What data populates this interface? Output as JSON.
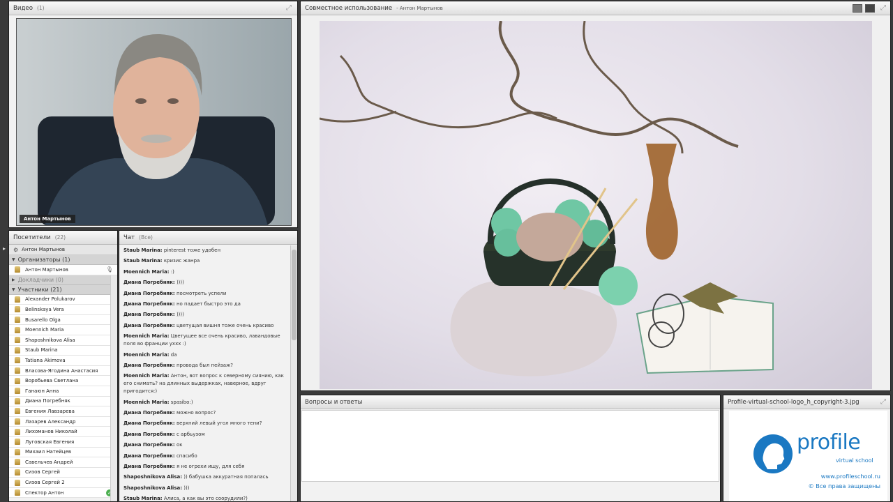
{
  "video": {
    "title": "Видео",
    "count": "(1)",
    "cam_name": "Антон Мартынов"
  },
  "share": {
    "title": "Совместное использование",
    "presenter": "- Антон Мартынов"
  },
  "attendees": {
    "title": "Посетители",
    "count": "(22)",
    "presenter": "Антон Мартынов",
    "groups": {
      "organizers": "Организаторы (1)",
      "speakers": "Докладчики (0)",
      "participants": "Участники (21)"
    },
    "organizers": [
      "Антон Мартынов"
    ],
    "participants": [
      "Alexander Polukarov",
      "Belinskaya Vera",
      "Busarello Olga",
      "Moennich Maria",
      "Shaposhnikova Alisa",
      "Staub Marina",
      "Tatiana Akimova",
      "Власова-Ягодина Анастасия",
      "Воробьева Светлана",
      "Ганаюн Анна",
      "Диана Погребняк",
      "Евгения Лавзарева",
      "Лазарев Александр",
      "Лихоманов Николай",
      "Луговская Евгения",
      "Михаил Натейцев",
      "Савельчев Андрей",
      "Сизов Сергей",
      "Сизов Сергей 2",
      "Спектор Антон"
    ]
  },
  "chat": {
    "title": "Чат",
    "scope": "(Все)",
    "messages": [
      {
        "author": "Staub Marina:",
        "text": "pinterest тоже удобен"
      },
      {
        "author": "Staub Marina:",
        "text": "кризис жанра"
      },
      {
        "author": "Moennich Maria:",
        "text": ":)"
      },
      {
        "author": "Диана Погребняк:",
        "text": "))))"
      },
      {
        "author": "Диана Погребняк:",
        "text": "посмотреть успели"
      },
      {
        "author": "Диана Погребняк:",
        "text": "но падает быстро это да"
      },
      {
        "author": "Диана Погребняк:",
        "text": "))))"
      },
      {
        "author": "Диана Погребняк:",
        "text": "цветущая вишня тоже очень красиво"
      },
      {
        "author": "Moennich Maria:",
        "text": "Цветущее все очень красиво, лавандовые поля во франции уххх :)"
      },
      {
        "author": "Moennich Maria:",
        "text": "da"
      },
      {
        "author": "Диана Погребняк:",
        "text": "провода был пейзаж?"
      },
      {
        "author": "Moennich Maria:",
        "text": "Антон, вот вопрос к северному сиянию, как его снимать? на длинных выдержках, наверное, вдруг пригодится:)"
      },
      {
        "author": "Moennich Maria:",
        "text": "spasibo:)"
      },
      {
        "author": "Диана Погребняк:",
        "text": "можно вопрос?"
      },
      {
        "author": "Диана Погребняк:",
        "text": "верхний левый угол много тени?"
      },
      {
        "author": "Диана Погребняк:",
        "text": "с арбьузом"
      },
      {
        "author": "Диана Погребняк:",
        "text": "ок"
      },
      {
        "author": "Диана Погребняк:",
        "text": "спасибо"
      },
      {
        "author": "Диана Погребняк:",
        "text": "я не огрехи ищу,  для себя"
      },
      {
        "author": "Shaposhnikova Alisa:",
        "text": ")) бабушка аккуратная попалась"
      },
      {
        "author": "Shaposhnikova Alisa:",
        "text": ")))"
      },
      {
        "author": "Staub Marina:",
        "text": "Алиса, а как вы это соорудили?)"
      }
    ]
  },
  "qa": {
    "title": "Вопросы и ответы"
  },
  "file": {
    "title": "Profile-virtual-school-logo_h_copyright-3.jpg",
    "logo_word": "profile",
    "logo_tag": "virtual school",
    "url": "www.profileschool.ru",
    "copyright": "© Все права защищены"
  },
  "colors": {
    "brand_blue": "#1a78c2",
    "status_green": "#4caf50"
  }
}
